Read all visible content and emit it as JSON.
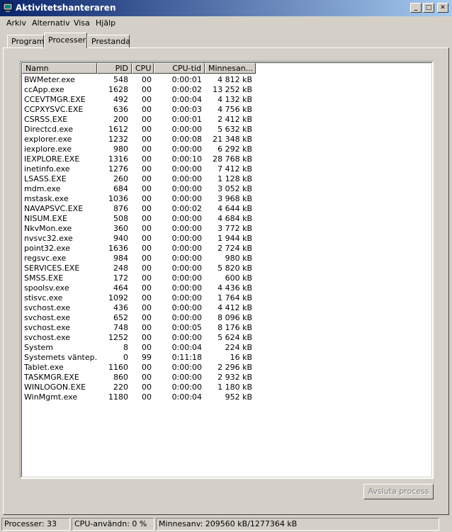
{
  "window": {
    "title": "Aktivitetshanteraren",
    "icon": "task-manager-icon",
    "min": "_",
    "max": "□",
    "close": "✕"
  },
  "menu": {
    "file": "Arkiv",
    "options": "Alternativ",
    "view": "Visa",
    "help": "Hjälp"
  },
  "tabs": [
    {
      "label": "Program"
    },
    {
      "label": "Processer",
      "active": true
    },
    {
      "label": "Prestanda"
    }
  ],
  "columns": {
    "name": "Namn",
    "pid": "PID",
    "cpu": "CPU",
    "cputime": "CPU-tid",
    "mem": "Minnesan..."
  },
  "processes": [
    [
      "BWMeter.exe",
      "548",
      "00",
      "0:00:01",
      "4 812 kB"
    ],
    [
      "ccApp.exe",
      "1628",
      "00",
      "0:00:02",
      "13 252 kB"
    ],
    [
      "CCEVTMGR.EXE",
      "492",
      "00",
      "0:00:04",
      "4 132 kB"
    ],
    [
      "CCPXYSVC.EXE",
      "636",
      "00",
      "0:00:03",
      "4 756 kB"
    ],
    [
      "CSRSS.EXE",
      "200",
      "00",
      "0:00:01",
      "2 412 kB"
    ],
    [
      "Directcd.exe",
      "1612",
      "00",
      "0:00:00",
      "5 632 kB"
    ],
    [
      "explorer.exe",
      "1232",
      "00",
      "0:00:08",
      "21 348 kB"
    ],
    [
      "iexplore.exe",
      "980",
      "00",
      "0:00:00",
      "6 292 kB"
    ],
    [
      "IEXPLORE.EXE",
      "1316",
      "00",
      "0:00:10",
      "28 768 kB"
    ],
    [
      "inetinfo.exe",
      "1276",
      "00",
      "0:00:00",
      "7 412 kB"
    ],
    [
      "LSASS.EXE",
      "260",
      "00",
      "0:00:00",
      "1 128 kB"
    ],
    [
      "mdm.exe",
      "684",
      "00",
      "0:00:00",
      "3 052 kB"
    ],
    [
      "mstask.exe",
      "1036",
      "00",
      "0:00:00",
      "3 968 kB"
    ],
    [
      "NAVAPSVC.EXE",
      "876",
      "00",
      "0:00:02",
      "4 644 kB"
    ],
    [
      "NISUM.EXE",
      "508",
      "00",
      "0:00:00",
      "4 684 kB"
    ],
    [
      "NkvMon.exe",
      "360",
      "00",
      "0:00:00",
      "3 772 kB"
    ],
    [
      "nvsvc32.exe",
      "940",
      "00",
      "0:00:00",
      "1 944 kB"
    ],
    [
      "point32.exe",
      "1636",
      "00",
      "0:00:00",
      "2 724 kB"
    ],
    [
      "regsvc.exe",
      "984",
      "00",
      "0:00:00",
      "980 kB"
    ],
    [
      "SERVICES.EXE",
      "248",
      "00",
      "0:00:00",
      "5 820 kB"
    ],
    [
      "SMSS.EXE",
      "172",
      "00",
      "0:00:00",
      "600 kB"
    ],
    [
      "spoolsv.exe",
      "464",
      "00",
      "0:00:00",
      "4 436 kB"
    ],
    [
      "stisvc.exe",
      "1092",
      "00",
      "0:00:00",
      "1 764 kB"
    ],
    [
      "svchost.exe",
      "436",
      "00",
      "0:00:00",
      "4 412 kB"
    ],
    [
      "svchost.exe",
      "652",
      "00",
      "0:00:00",
      "8 096 kB"
    ],
    [
      "svchost.exe",
      "748",
      "00",
      "0:00:05",
      "8 176 kB"
    ],
    [
      "svchost.exe",
      "1252",
      "00",
      "0:00:00",
      "5 624 kB"
    ],
    [
      "System",
      "8",
      "00",
      "0:00:04",
      "224 kB"
    ],
    [
      "Systemets väntep...",
      "0",
      "99",
      "0:11:18",
      "16 kB"
    ],
    [
      "Tablet.exe",
      "1160",
      "00",
      "0:00:00",
      "2 296 kB"
    ],
    [
      "TASKMGR.EXE",
      "860",
      "00",
      "0:00:00",
      "2 932 kB"
    ],
    [
      "WINLOGON.EXE",
      "220",
      "00",
      "0:00:00",
      "1 180 kB"
    ],
    [
      "WinMgmt.exe",
      "1180",
      "00",
      "0:00:04",
      "952 kB"
    ]
  ],
  "end_process_button": "Avsluta process",
  "status": {
    "processes": "Processer: 33",
    "cpu": "CPU-användn: 0 %",
    "memory": "Minnesanv: 209560 kB/1277364 kB"
  }
}
